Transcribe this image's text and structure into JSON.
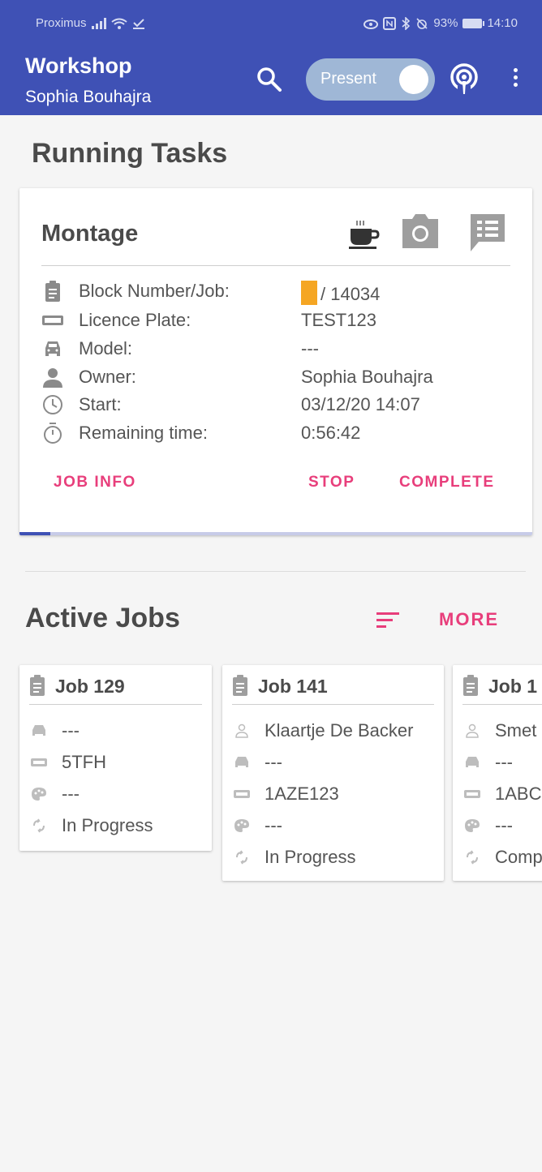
{
  "status_bar": {
    "carrier": "Proximus",
    "battery": "93%",
    "time": "14:10"
  },
  "app_bar": {
    "title": "Workshop",
    "subtitle": "Sophia Bouhajra",
    "toggle_label": "Present",
    "toggle_on": true,
    "bg_color": "#3f51b5"
  },
  "running": {
    "heading": "Running Tasks",
    "task": {
      "name": "Montage",
      "fields": [
        {
          "icon": "clipboard-icon",
          "label": "Block Number/Job:",
          "value": "/ 14034"
        },
        {
          "icon": "licence-plate-icon",
          "label": "Licence Plate:",
          "value": "TEST123"
        },
        {
          "icon": "car-icon",
          "label": "Model:",
          "value": "---"
        },
        {
          "icon": "person-icon",
          "label": "Owner:",
          "value": "Sophia Bouhajra"
        },
        {
          "icon": "clock-icon",
          "label": "Start:",
          "value": "03/12/20 14:07"
        },
        {
          "icon": "stopwatch-icon",
          "label": "Remaining time:",
          "value": "0:56:42"
        }
      ],
      "actions": {
        "job_info": "JOB INFO",
        "stop": "STOP",
        "complete": "COMPLETE"
      },
      "progress": 0.06
    }
  },
  "active": {
    "heading": "Active Jobs",
    "more_label": "MORE",
    "jobs": [
      {
        "title": "Job 129",
        "rows": [
          {
            "icon": "car-icon",
            "text": "---"
          },
          {
            "icon": "licence-plate-icon",
            "text": "5TFH"
          },
          {
            "icon": "palette-icon",
            "text": "---"
          },
          {
            "icon": "sync-icon",
            "text": "In Progress"
          }
        ]
      },
      {
        "title": "Job 141",
        "rows": [
          {
            "icon": "person-outline-icon",
            "text": "Klaartje De Backer"
          },
          {
            "icon": "car-icon",
            "text": "---"
          },
          {
            "icon": "licence-plate-icon",
            "text": "1AZE123"
          },
          {
            "icon": "palette-icon",
            "text": "---"
          },
          {
            "icon": "sync-icon",
            "text": "In Progress"
          }
        ]
      },
      {
        "title": "Job 1",
        "rows": [
          {
            "icon": "person-outline-icon",
            "text": "Smet"
          },
          {
            "icon": "car-icon",
            "text": "---"
          },
          {
            "icon": "licence-plate-icon",
            "text": "1ABC"
          },
          {
            "icon": "palette-icon",
            "text": "---"
          },
          {
            "icon": "sync-icon",
            "text": "Comp"
          }
        ]
      }
    ]
  },
  "colors": {
    "primary": "#3f51b5",
    "accent": "#e83e7b",
    "highlight": "#f5a623"
  }
}
